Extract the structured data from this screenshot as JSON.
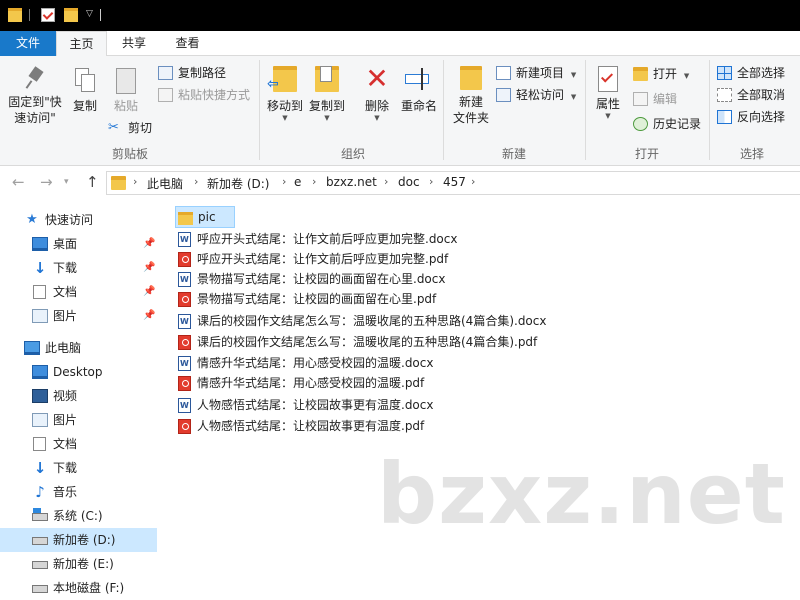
{
  "titlebar": {
    "icons": [
      "folder-icon",
      "checkmark-icon",
      "folder-icon",
      "dropdown-icon"
    ]
  },
  "tabs": {
    "file": "文件",
    "home": "主页",
    "share": "共享",
    "view": "查看"
  },
  "ribbon": {
    "clipboard": {
      "pin_quick_access": "固定到\"快",
      "pin_quick_access_2": "速访问\"",
      "copy": "复制",
      "paste": "粘贴",
      "copy_path": "复制路径",
      "paste_shortcut": "粘贴快捷方式",
      "cut": "剪切",
      "label": "剪贴板"
    },
    "organize": {
      "move_to": "移动到",
      "copy_to": "复制到",
      "delete": "删除",
      "rename": "重命名",
      "label": "组织"
    },
    "new": {
      "new_folder": "新建",
      "new_folder_2": "文件夹",
      "new_item": "新建项目",
      "easy_access": "轻松访问",
      "label": "新建"
    },
    "open": {
      "properties": "属性",
      "open": "打开",
      "edit": "编辑",
      "history": "历史记录",
      "label": "打开"
    },
    "select": {
      "select_all": "全部选择",
      "select_none": "全部取消",
      "invert": "反向选择",
      "label": "选择"
    }
  },
  "address": {
    "crumbs": [
      "此电脑",
      "新加卷 (D:)",
      "e",
      "bzxz.net",
      "doc",
      "457"
    ]
  },
  "navpane": {
    "items": [
      {
        "label": "快速访问",
        "icon": "star-icon"
      },
      {
        "label": "桌面",
        "icon": "desktop-icon",
        "pinned": true
      },
      {
        "label": "下载",
        "icon": "download-icon",
        "pinned": true
      },
      {
        "label": "文档",
        "icon": "documents-icon",
        "pinned": true
      },
      {
        "label": "图片",
        "icon": "pictures-icon",
        "pinned": true
      },
      {
        "label": "此电脑",
        "icon": "computer-icon"
      },
      {
        "label": "Desktop",
        "icon": "desktop-icon"
      },
      {
        "label": "视频",
        "icon": "video-icon"
      },
      {
        "label": "图片",
        "icon": "pictures-icon"
      },
      {
        "label": "文档",
        "icon": "documents-icon"
      },
      {
        "label": "下载",
        "icon": "download-icon"
      },
      {
        "label": "音乐",
        "icon": "music-icon"
      },
      {
        "label": "系统 (C:)",
        "icon": "system-drive-icon"
      },
      {
        "label": "新加卷 (D:)",
        "icon": "drive-icon",
        "selected": true
      },
      {
        "label": "新加卷 (E:)",
        "icon": "drive-icon"
      },
      {
        "label": "本地磁盘 (F:)",
        "icon": "drive-icon"
      }
    ]
  },
  "files": [
    {
      "name": "pic",
      "type": "folder"
    },
    {
      "name": "呼应开头式结尾：让作文前后呼应更加完整.docx",
      "type": "docx"
    },
    {
      "name": "呼应开头式结尾：让作文前后呼应更加完整.pdf",
      "type": "pdf"
    },
    {
      "name": "景物描写式结尾：让校园的画面留在心里.docx",
      "type": "docx"
    },
    {
      "name": "景物描写式结尾：让校园的画面留在心里.pdf",
      "type": "pdf"
    },
    {
      "name": "课后的校园作文结尾怎么写：温暖收尾的五种思路(4篇合集).docx",
      "type": "docx"
    },
    {
      "name": "课后的校园作文结尾怎么写：温暖收尾的五种思路(4篇合集).pdf",
      "type": "pdf"
    },
    {
      "name": "情感升华式结尾：用心感受校园的温暖.docx",
      "type": "docx"
    },
    {
      "name": "情感升华式结尾：用心感受校园的温暖.pdf",
      "type": "pdf"
    },
    {
      "name": "人物感悟式结尾：让校园故事更有温度.docx",
      "type": "docx"
    },
    {
      "name": "人物感悟式结尾：让校园故事更有温度.pdf",
      "type": "pdf"
    }
  ],
  "watermark": "bzxz.net"
}
